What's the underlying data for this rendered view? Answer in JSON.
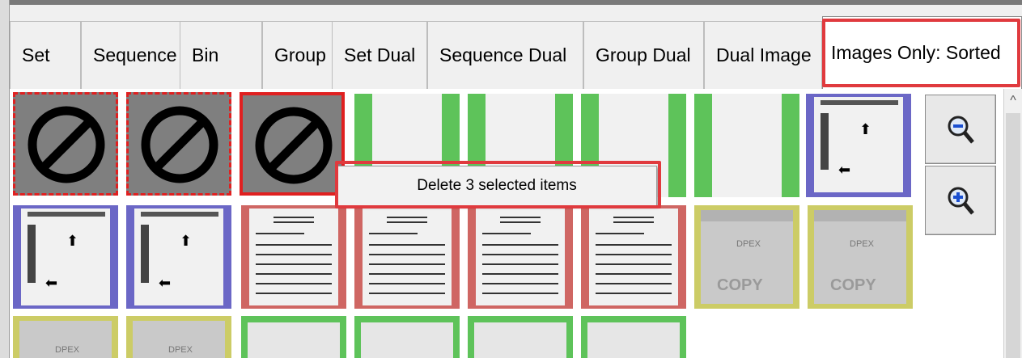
{
  "tabs": [
    {
      "label": "Set"
    },
    {
      "label": "Sequence"
    },
    {
      "label": "Bin"
    },
    {
      "label": "Group"
    },
    {
      "label": "Set Dual"
    },
    {
      "label": "Sequence Dual"
    },
    {
      "label": "Group Dual"
    },
    {
      "label": "Dual Image"
    },
    {
      "label": "Images Only: Sorted",
      "active": true
    }
  ],
  "context_menu": {
    "delete_label": "Delete 3 selected items"
  },
  "thumbnails": {
    "row1": [
      "deleted",
      "deleted",
      "deleted",
      "green",
      "green",
      "green",
      "green",
      "blue"
    ],
    "row2": [
      "blue",
      "blue",
      "red",
      "red",
      "red",
      "red",
      "yellow",
      "yellow"
    ],
    "row3": [
      "yellow",
      "yellow",
      "green",
      "green",
      "green",
      "green"
    ],
    "check_stamp_text": "DPEX",
    "copy_watermark": "COPY"
  },
  "zoom": {
    "zoom_out_icon": "zoom-out-icon",
    "zoom_in_icon": "zoom-in-icon"
  },
  "colors": {
    "highlight": "#e03a3e",
    "green": "#5ec35a",
    "blue": "#6b67c6",
    "red": "#cf6663",
    "yellow": "#cccc66",
    "deleted_bg": "#7f7f7f"
  }
}
